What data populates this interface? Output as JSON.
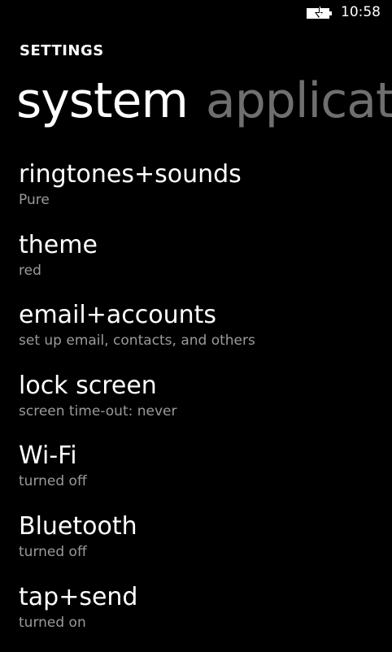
{
  "status_bar": {
    "time": "10:58",
    "battery_icon": "battery-charging-icon"
  },
  "header": {
    "app_title": "SETTINGS"
  },
  "pivot": {
    "tabs": [
      {
        "label": "system",
        "active": true
      },
      {
        "label": "applicat",
        "active": false
      }
    ]
  },
  "settings": {
    "items": [
      {
        "title": "ringtones+sounds",
        "subtitle": "Pure"
      },
      {
        "title": "theme",
        "subtitle": "red"
      },
      {
        "title": "email+accounts",
        "subtitle": "set up email, contacts, and others"
      },
      {
        "title": "lock screen",
        "subtitle": "screen time-out: never"
      },
      {
        "title": "Wi-Fi",
        "subtitle": "turned off"
      },
      {
        "title": "Bluetooth",
        "subtitle": "turned off"
      },
      {
        "title": "tap+send",
        "subtitle": "turned on"
      }
    ]
  },
  "colors": {
    "background": "#000000",
    "text_primary": "#ffffff",
    "text_secondary": "#9a9a9a",
    "pivot_inactive": "#6f6f6f"
  }
}
